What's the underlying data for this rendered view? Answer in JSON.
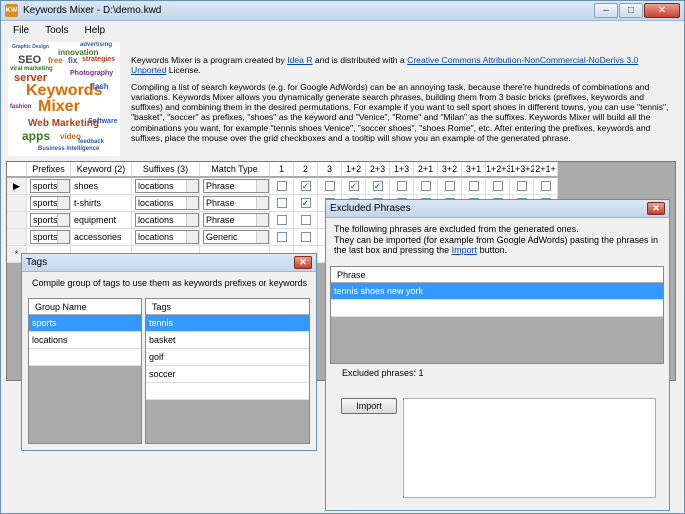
{
  "app": {
    "title": "Keywords Mixer - D:\\demo.kwd",
    "icon": "km-app-icon"
  },
  "menu": [
    "File",
    "Tools",
    "Help"
  ],
  "intro": {
    "p1_a": "Keywords Mixer is a program created by ",
    "p1_link1": "Idea R",
    "p1_b": " and is distributed with a ",
    "p1_link2": "Creative Commons Attribution-NonCommercial-NoDerivs 3.0 Unported",
    "p1_c": " License.",
    "p2": "Compiling a list of search keywords (e.g.  for Google AdWords) can be an annoying task, because there're hundreds of combinations and variations. Keywords Mixer allows you dynamically generate search phrases, building them from 3 basic bricks (prefixes, keywords and suffixes) and combining them in the desired permutations. For example if you want to sell sport shoes in different towns, you can use \"tennis\", \"basket\", \"soccer\" as prefixes, \"shoes\" as the keyword and \"Venice\", \"Rome\" and \"Milan\" as the suffixes.  Keywords Mixer will build all the combinations you want, for example \"tennis shoes Venice\", \"soccer shoes\", \"shoes Rome\", etc. After entering the prefixes, keywords and suffixes, place the mouse over the grid checkboxes and a tooltip will show you an example of the generated phrase."
  },
  "cloud_words": [
    "Keywords",
    "Mixer",
    "SEO",
    "Web Marketing",
    "apps",
    "server",
    "viral marketing",
    "Photography",
    "innovation",
    "strategies",
    "advertising",
    "feedback",
    "Graphic Design",
    "Business Intelligence",
    "video",
    "flash",
    "Software",
    "fashion",
    "fix",
    "free"
  ],
  "grid": {
    "headers": [
      "Prefixes (1)",
      "Keyword (2)",
      "Suffixes (3)",
      "Match Type",
      "1",
      "2",
      "3",
      "1+2",
      "2+3",
      "1+3",
      "2+1",
      "3+2",
      "3+1",
      "1+2+3",
      "1+3+2",
      "2+1+"
    ],
    "rows": [
      {
        "prefix": "sports",
        "keyword": "shoes",
        "suffix": "locations",
        "match": "Phrase",
        "checks": [
          false,
          true,
          false,
          true,
          true,
          false,
          false,
          false,
          false,
          false,
          false,
          false
        ]
      },
      {
        "prefix": "sports",
        "keyword": "t-shirts",
        "suffix": "locations",
        "match": "Phrase",
        "checks": [
          false,
          true,
          false,
          false,
          false,
          false,
          false,
          false,
          false,
          false,
          false,
          false
        ]
      },
      {
        "prefix": "sports",
        "keyword": "equipment",
        "suffix": "locations",
        "match": "Phrase",
        "checks": [
          false,
          false,
          false,
          false,
          false,
          false,
          false,
          false,
          false,
          false,
          false,
          false
        ]
      },
      {
        "prefix": "sports",
        "keyword": "accessories",
        "suffix": "locations",
        "match": "Generic",
        "checks": [
          false,
          false,
          false,
          false,
          false,
          false,
          false,
          false,
          false,
          false,
          false,
          false
        ]
      }
    ]
  },
  "tags_dialog": {
    "title": "Tags",
    "desc": "Compile group of tags to use them as keywords prefixes or keywords",
    "group_header": "Group Name",
    "groups": [
      "sports",
      "locations"
    ],
    "tags_header": "Tags",
    "tags": [
      "tennis",
      "basket",
      "golf",
      "soccer"
    ]
  },
  "excluded_dialog": {
    "title": "Excluded Phrases",
    "desc": "The following phrases are excluded from the generated ones.\nThey can be imported (for example from Google AdWords) pasting the phrases in the last box and pressing the ",
    "desc_link": "Import",
    "desc_end": " button.",
    "phrase_header": "Phrase",
    "phrases": [
      "tennis shoes new york"
    ],
    "count_label": "Excluded phrases: 1",
    "import_label": "Import"
  }
}
